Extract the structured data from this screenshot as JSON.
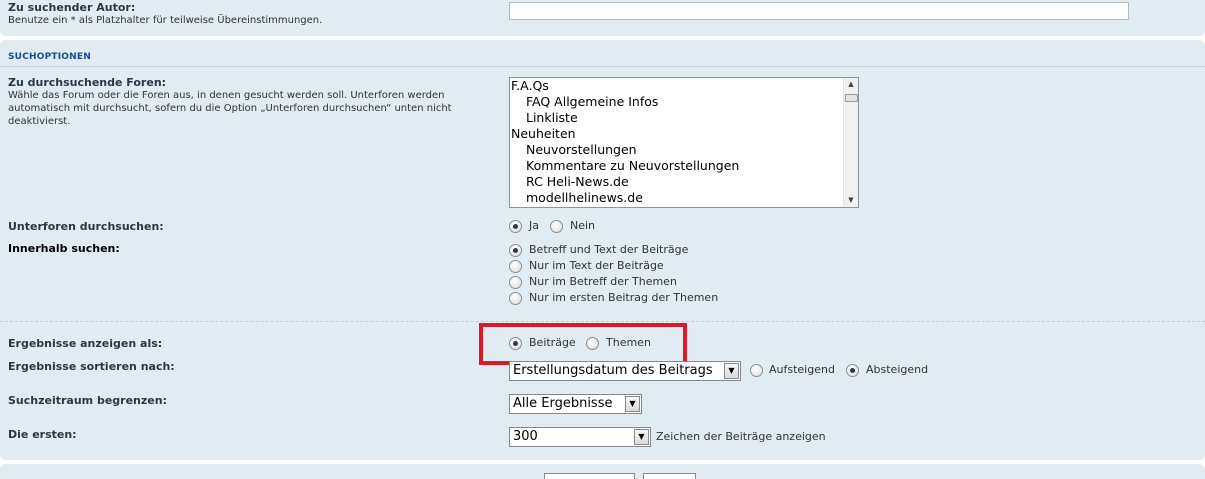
{
  "author": {
    "label": "Zu suchender Autor:",
    "explain": "Benutze ein * als Platzhalter für teilweise Übereinstimmungen.",
    "value": ""
  },
  "search_options": {
    "title": "Suchoptionen",
    "forums": {
      "label": "Zu durchsuchende Foren:",
      "explain": "Wähle das Forum oder die Foren aus, in denen gesucht werden soll. Unterforen werden automatisch mit durchsucht, sofern du die Option „Unterforen durchsuchen“ unten nicht deaktivierst.",
      "options": [
        {
          "text": "F.A.Qs",
          "indent": false
        },
        {
          "text": "FAQ Allgemeine Infos",
          "indent": true
        },
        {
          "text": "Linkliste",
          "indent": true
        },
        {
          "text": "Neuheiten",
          "indent": false
        },
        {
          "text": "Neuvorstellungen",
          "indent": true
        },
        {
          "text": "Kommentare zu Neuvorstellungen",
          "indent": true
        },
        {
          "text": "RC Heli-News.de",
          "indent": true
        },
        {
          "text": "modellhelinews.de",
          "indent": true
        }
      ]
    },
    "subforums": {
      "label": "Unterforen durchsuchen:",
      "yes": "Ja",
      "no": "Nein",
      "selected": "Ja"
    },
    "search_within": {
      "label": "Innerhalb suchen:",
      "options": [
        "Betreff und Text der Beiträge",
        "Nur im Text der Beiträge",
        "Nur im Betreff der Themen",
        "Nur im ersten Beitrag der Themen"
      ],
      "selected_index": 0
    },
    "display_as": {
      "label": "Ergebnisse anzeigen als:",
      "posts": "Beiträge",
      "topics": "Themen",
      "selected": "Beiträge"
    },
    "sort_by": {
      "label": "Ergebnisse sortieren nach:",
      "value": "Erstellungsdatum des Beitrags",
      "ascending": "Aufsteigend",
      "descending": "Absteigend",
      "selected": "Absteigend"
    },
    "time_limit": {
      "label": "Suchzeitraum begrenzen:",
      "value": "Alle Ergebnisse"
    },
    "first_chars": {
      "label": "Die ersten:",
      "value": "300",
      "suffix": "Zeichen der Beiträge anzeigen"
    }
  },
  "icons": {
    "dropdown": "chevron-down-icon",
    "scroll_up": "arrow-up-icon",
    "scroll_down": "arrow-down-icon"
  },
  "colors": {
    "panel": "#e1ebf2",
    "section_title": "#115098",
    "highlight": "#d91b28"
  }
}
